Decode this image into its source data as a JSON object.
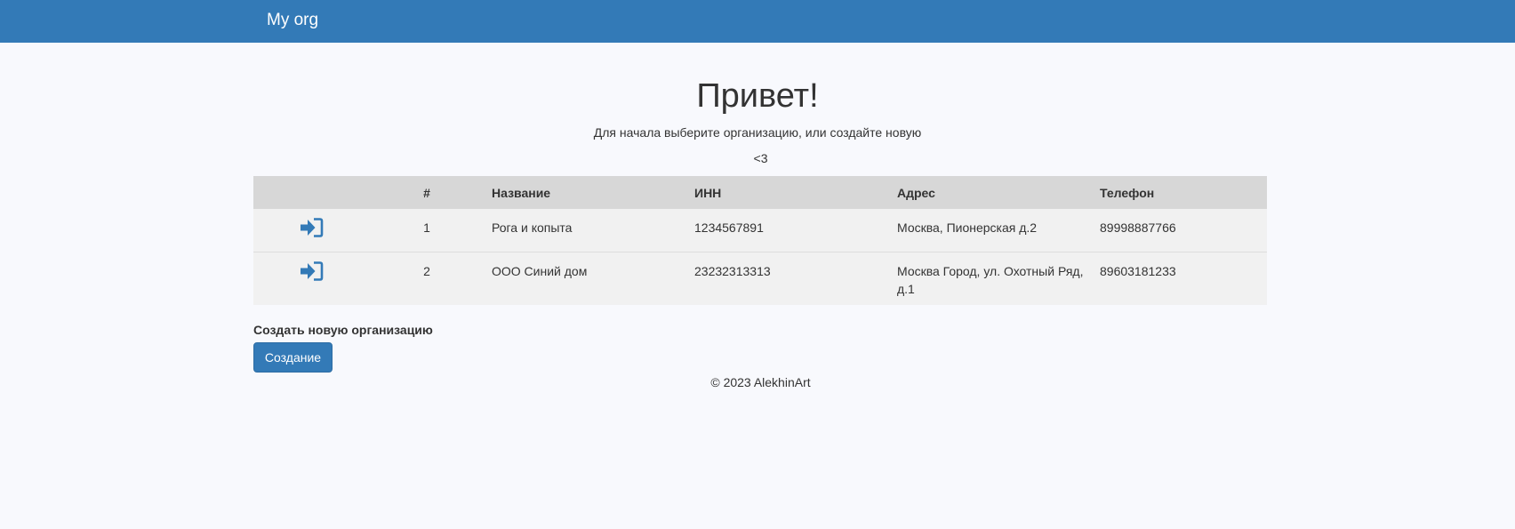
{
  "navbar": {
    "brand": "My org",
    "color": "#337ab7"
  },
  "hero": {
    "title": "Привет!",
    "subtitle": "Для начала выберите организацию, или создайте новую",
    "note": "<3"
  },
  "table": {
    "headers": [
      "",
      "#",
      "Название",
      "ИНН",
      "Адрес",
      "Телефон"
    ],
    "rows": [
      {
        "icon": "sign-in-icon",
        "number": "1",
        "name": "Рога и копыта",
        "inn": "1234567891",
        "address": "Москва, Пионерская д.2",
        "phone": "89998887766"
      },
      {
        "icon": "sign-in-icon",
        "number": "2",
        "name": "ООО Синий дом",
        "inn": "23232313313",
        "address": "Москва Город, ул. Охотный Ряд, д.1",
        "phone": "89603181233"
      }
    ]
  },
  "create": {
    "label": "Создать новую организацию",
    "button_label": "Создание"
  },
  "footer": {
    "text": "© 2023 AlekhinArt"
  },
  "colors": {
    "accent": "#337ab7",
    "background": "#f8f9fd",
    "table_header": "#d7d7d7",
    "table_row": "#f1f1f1"
  }
}
